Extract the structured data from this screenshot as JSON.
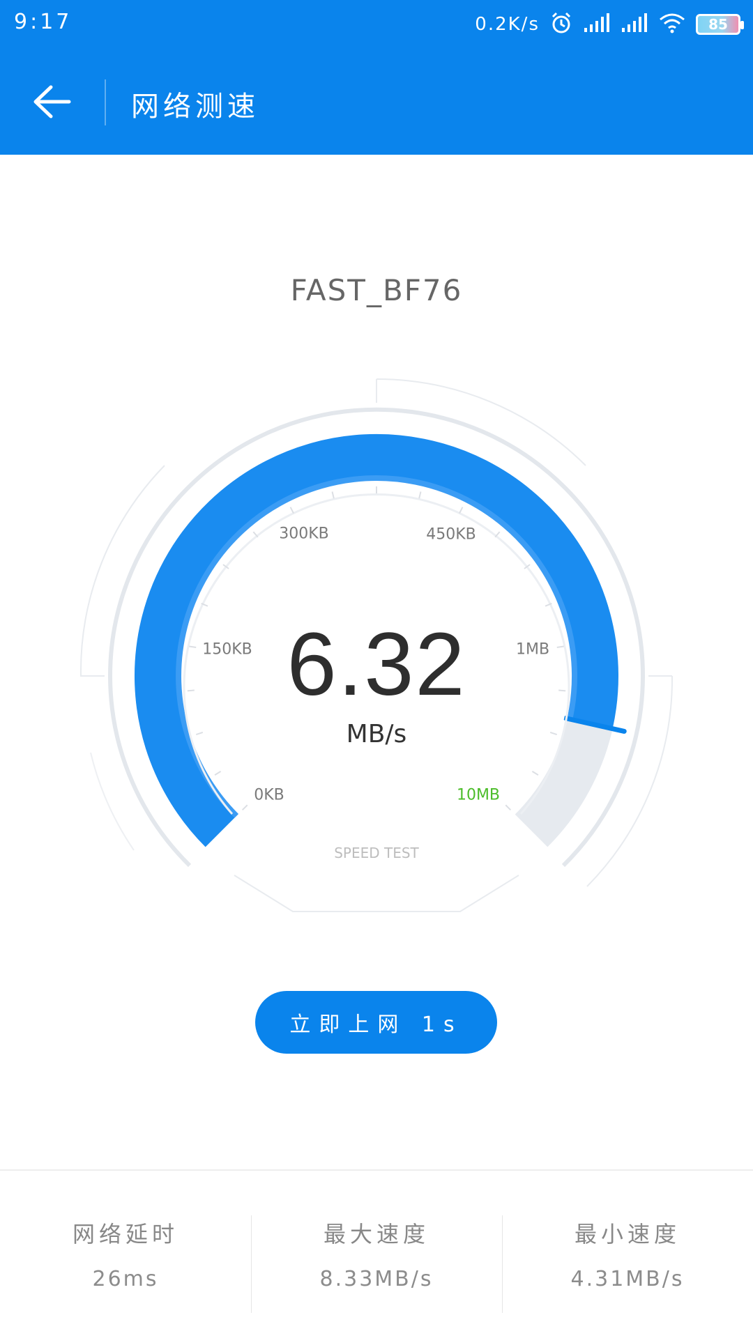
{
  "status_bar": {
    "time": "9:17",
    "net_speed": "0.2K/s",
    "battery": "85",
    "icons": [
      "alarm-icon",
      "signal-icon",
      "signal-icon",
      "wifi-icon",
      "battery-icon"
    ]
  },
  "app_bar": {
    "title": "网络测速",
    "back_icon": "arrow-left-icon"
  },
  "network": {
    "ssid": "FAST_BF76"
  },
  "gauge": {
    "value": "6.32",
    "unit": "MB/s",
    "caption": "SPEED TEST",
    "fill_fraction": 0.88,
    "labels": [
      "0KB",
      "150KB",
      "300KB",
      "450KB",
      "1MB",
      "10MB"
    ],
    "colors": {
      "primary": "#0a84ec",
      "track": "#e6eaef",
      "highlight": "#4cbd2a"
    }
  },
  "action_button": {
    "label": "立即上网 1s"
  },
  "stats": [
    {
      "label": "网络延时",
      "value": "26ms"
    },
    {
      "label": "最大速度",
      "value": "8.33MB/s"
    },
    {
      "label": "最小速度",
      "value": "4.31MB/s"
    }
  ]
}
